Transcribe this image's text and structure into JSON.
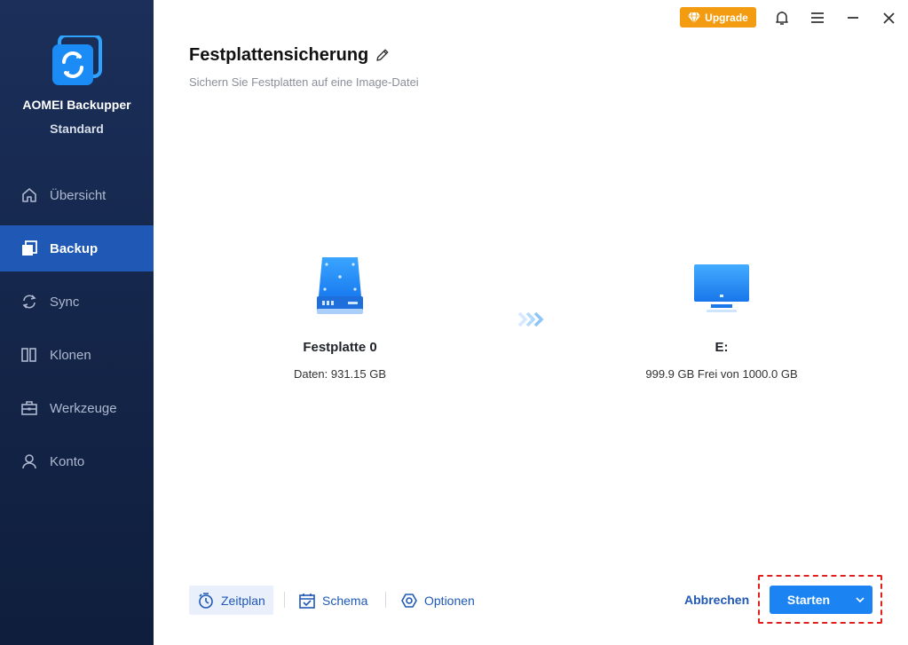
{
  "app": {
    "name": "AOMEI Backupper",
    "edition": "Standard"
  },
  "topbar": {
    "upgrade_label": "Upgrade"
  },
  "sidebar": {
    "items": [
      {
        "label": "Übersicht",
        "icon": "home-icon"
      },
      {
        "label": "Backup",
        "icon": "backup-icon",
        "active": true
      },
      {
        "label": "Sync",
        "icon": "sync-icon"
      },
      {
        "label": "Klonen",
        "icon": "clone-icon"
      },
      {
        "label": "Werkzeuge",
        "icon": "toolbox-icon"
      },
      {
        "label": "Konto",
        "icon": "user-icon"
      }
    ]
  },
  "header": {
    "title": "Festplattensicherung",
    "subtitle": "Sichern Sie Festplatten auf eine Image-Datei"
  },
  "source": {
    "name": "Festplatte 0",
    "info": "Daten: 931.15 GB"
  },
  "destination": {
    "name": "E:",
    "info": "999.9 GB Frei von 1000.0 GB"
  },
  "bottom": {
    "zeitplan_label": "Zeitplan",
    "schema_label": "Schema",
    "optionen_label": "Optionen",
    "cancel_label": "Abbrechen",
    "start_label": "Starten"
  },
  "colors": {
    "accent": "#1b84f2",
    "sidebar_bg": "#132447",
    "sidebar_active": "#1f58b5",
    "upgrade": "#f39c12",
    "highlight_dash": "#e0201c"
  }
}
